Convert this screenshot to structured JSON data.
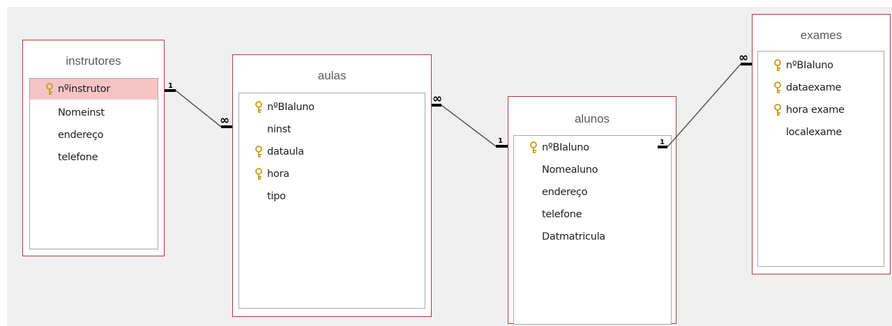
{
  "tables": {
    "instrutores": {
      "title": "instrutores",
      "fields": [
        {
          "name": "nºinstrutor",
          "key": true,
          "selected": true
        },
        {
          "name": "Nomeinst",
          "key": false
        },
        {
          "name": "endereço",
          "key": false
        },
        {
          "name": "telefone",
          "key": false
        }
      ]
    },
    "aulas": {
      "title": "aulas",
      "fields": [
        {
          "name": "nºBIaluno",
          "key": true
        },
        {
          "name": "ninst",
          "key": false
        },
        {
          "name": "dataula",
          "key": true
        },
        {
          "name": "hora",
          "key": true
        },
        {
          "name": "tipo",
          "key": false
        }
      ]
    },
    "alunos": {
      "title": "alunos",
      "fields": [
        {
          "name": "nºBIaluno",
          "key": true
        },
        {
          "name": "Nomealuno",
          "key": false
        },
        {
          "name": "endereço",
          "key": false
        },
        {
          "name": "telefone",
          "key": false
        },
        {
          "name": "Datmatricula",
          "key": false
        }
      ]
    },
    "exames": {
      "title": "exames",
      "fields": [
        {
          "name": "nºBIaluno",
          "key": true
        },
        {
          "name": "dataexame",
          "key": true
        },
        {
          "name": "hora exame",
          "key": true
        },
        {
          "name": "localexame",
          "key": false
        }
      ]
    }
  },
  "relationships": [
    {
      "from": "instrutores",
      "to": "aulas",
      "from_card": "1",
      "to_card": "∞"
    },
    {
      "from": "aulas",
      "to": "alunos",
      "from_card": "∞",
      "to_card": "1"
    },
    {
      "from": "alunos",
      "to": "exames",
      "from_card": "1",
      "to_card": "∞"
    }
  ],
  "colors": {
    "canvas": "#f0f0f0",
    "table_border": "#b23a3a",
    "selected_row": "#f6c4c4",
    "key_icon": "#c9a227"
  }
}
